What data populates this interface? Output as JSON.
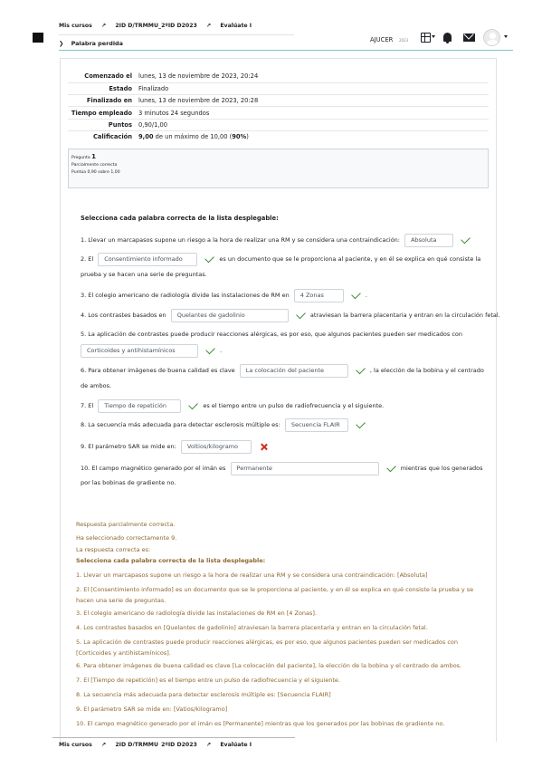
{
  "navbar": {
    "breadcrumb": [
      "Mis cursos",
      "2ID D/TRMMU_2ºID D2023",
      "Evalúate I"
    ],
    "breadcrumb_sep": "↗",
    "sub_breadcrumb": "Palabra perdida",
    "sub_chevron": "❯",
    "user_name": "AJUCER",
    "user_tag": "2023",
    "icons": [
      "menu-icon",
      "grid-icon",
      "bell-icon",
      "mail-icon",
      "avatar-icon"
    ]
  },
  "summary": [
    {
      "label": "Comenzado el",
      "value": "lunes, 13 de noviembre de 2023, 20:24"
    },
    {
      "label": "Estado",
      "value": "Finalizado"
    },
    {
      "label": "Finalizado en",
      "value": "lunes, 13 de noviembre de 2023, 20:28"
    },
    {
      "label": "Tiempo empleado",
      "value": "3 minutos 24 segundos"
    },
    {
      "label": "Puntos",
      "value": "0,90/1,00"
    }
  ],
  "grade": {
    "label": "Calificación",
    "value": "9,00",
    "mid": " de un máximo de 10,00 (",
    "pct": "90%",
    "end": ")"
  },
  "question_info": {
    "label": "Pregunta",
    "number": "1",
    "state": "Parcialmente correcta",
    "mark": "Puntúa 0,90 sobre 1,00"
  },
  "question": {
    "prompt": "Selecciona cada palabra correcta de la lista desplegable:",
    "items": [
      {
        "before": "1. Llevar un marcapasos supone un riesgo a la hora de realizar una RM y se considera una contraindicación:",
        "answer": "Absoluta",
        "after": "",
        "correct": true
      },
      {
        "before": "2. El",
        "answer": "Consentimiento informado",
        "after": "es un documento que se le proporciona al paciente, y en él se explica en qué consiste la",
        "after2": "prueba y se hacen una serie de preguntas.",
        "correct": true
      },
      {
        "before": "3. El colegio americano de radiología divide las instalaciones de RM en",
        "answer": "4 Zonas",
        "after": ".",
        "correct": true
      },
      {
        "before": "4. Los contrastes basados en",
        "answer": "Quelantes de gadolinio",
        "after": "atraviesan la barrera placentaria y entran en la circulación fetal.",
        "correct": true
      },
      {
        "before": "5. La aplicación de contrastes puede producir reacciones alérgicas, es por eso, que algunos pacientes pueden ser medicados con",
        "answer": "Corticoides y antihistamínicos",
        "after": ".",
        "correct": true
      },
      {
        "before": "6. Para obtener imágenes de buena calidad es clave",
        "answer": "La colocación del paciente",
        "after": ", la elección de la bobina y el centrado",
        "after2": "de ambos.",
        "correct": true
      },
      {
        "before": "7. El",
        "answer": "Tiempo de repetición",
        "after": "es el tiempo entre un pulso de radiofrecuencia y el siguiente.",
        "correct": true
      },
      {
        "before": "8. La secuencia más adecuada para detectar esclerosis múltiple es:",
        "answer": "Secuencia FLAIR",
        "after": "",
        "correct": true
      },
      {
        "before": "9. El parámetro SAR se mide en:",
        "answer": "Voltios/kilogramo",
        "after": "",
        "correct": false
      },
      {
        "before": "10. El campo magnético generado por el imán es",
        "answer": "Permanente",
        "after": "mientras que los generados",
        "after2": "por las bobinas de gradiente no.",
        "correct": true
      }
    ]
  },
  "feedback": {
    "status": "Respuesta parcialmente correcta.",
    "selected": "Ha seleccionado correctamente 9.",
    "correct_label": "La respuesta correcta es:",
    "prompt": "Selecciona cada palabra correcta de la lista desplegable:",
    "lines": [
      "1. Llevar un marcapasos supone un riesgo a la hora de realizar una RM y se considera una contraindicación: [Absoluta]",
      "2. El [Consentimiento informado] es un documento que se le proporciona al paciente, y en él se explica en qué consiste la prueba y se",
      "hacen una serie de preguntas.",
      "3. El colegio americano de radiología divide las instalaciones de RM en [4 Zonas].",
      "4. Los contrastes basados en [Quelantes de gadolinio] atraviesan la barrera placentaria y entran en la circulación fetal.",
      "5. La aplicación de contrastes puede producir reacciones alérgicas, es por eso, que algunos pacientes pueden ser medicados con",
      "[Corticoides y antihistamínicos].",
      "6. Para obtener imágenes de buena calidad es clave [La colocación del paciente], la elección de la bobina y el centrado de ambos.",
      "7. El [Tiempo de repetición] es el tiempo entre un pulso de radiofrecuencia y el siguiente.",
      "8. La secuencia más adecuada para detectar esclerosis múltiple es: [Secuencia FLAIR]",
      "9. El parámetro SAR se mide en: [Vatios/kilogramo]",
      "10. El campo magnético generado por el imán es [Permanente] mientras que los generados por las bobinas de gradiente no."
    ]
  },
  "colors": {
    "feedback": "#8e662e",
    "check": "#3a8a2e",
    "cross": "#ca3120",
    "nav_line": "#7fc7c0"
  }
}
